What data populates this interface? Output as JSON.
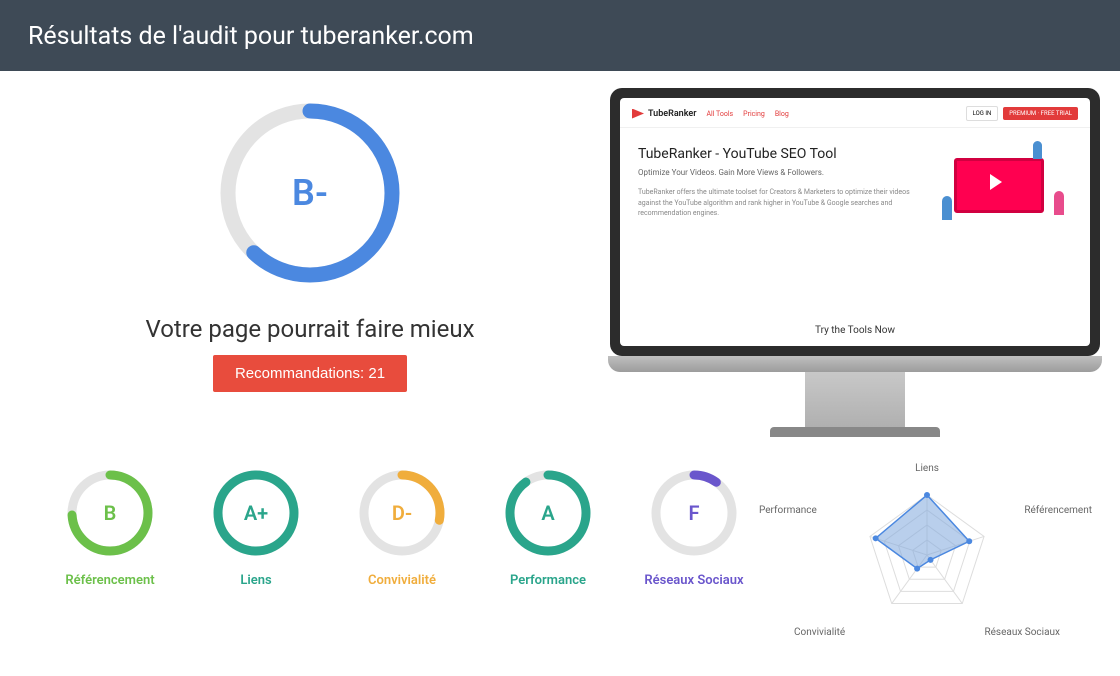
{
  "header": {
    "title": "Résultats de l'audit pour tuberanker.com"
  },
  "main": {
    "grade": "B-",
    "grade_pct": 62,
    "tagline": "Votre page pourrait faire mieux",
    "recommendations_label": "Recommandations: 21"
  },
  "preview": {
    "logo": "TubeRanker",
    "nav": [
      "All Tools",
      "Pricing",
      "Blog"
    ],
    "login": "LOG IN",
    "trial": "PREMIUM · FREE TRIAL",
    "title": "TubeRanker - YouTube SEO Tool",
    "subtitle": "Optimize Your Videos. Gain More Views & Followers.",
    "desc": "TubeRanker offers the ultimate toolset for Creators & Marketers to optimize their videos against the YouTube algorithm and rank higher in YouTube & Google searches and recommendation engines.",
    "cta": "Try the Tools Now"
  },
  "categories": [
    {
      "label": "Référencement",
      "grade": "B",
      "pct": 74,
      "color": "#6cc04a"
    },
    {
      "label": "Liens",
      "grade": "A+",
      "pct": 100,
      "color": "#2aa58b"
    },
    {
      "label": "Convivialité",
      "grade": "D-",
      "pct": 28,
      "color": "#f0ad3c"
    },
    {
      "label": "Performance",
      "grade": "A",
      "pct": 90,
      "color": "#2aa58b"
    },
    {
      "label": "Réseaux Sociaux",
      "grade": "F",
      "pct": 10,
      "color": "#6a56cc"
    }
  ],
  "radar": {
    "labels": [
      "Liens",
      "Référencement",
      "Réseaux Sociaux",
      "Convivialité",
      "Performance"
    ]
  },
  "chart_data": {
    "type": "radar",
    "title": "",
    "categories": [
      "Liens",
      "Référencement",
      "Réseaux Sociaux",
      "Convivialité",
      "Performance"
    ],
    "values": [
      100,
      74,
      10,
      28,
      90
    ],
    "range": [
      0,
      100
    ]
  },
  "colors": {
    "header_bg": "#3e4a56",
    "primary_blue": "#4b88e0",
    "danger": "#e84c3d",
    "grey_ring": "#e3e3e3"
  }
}
